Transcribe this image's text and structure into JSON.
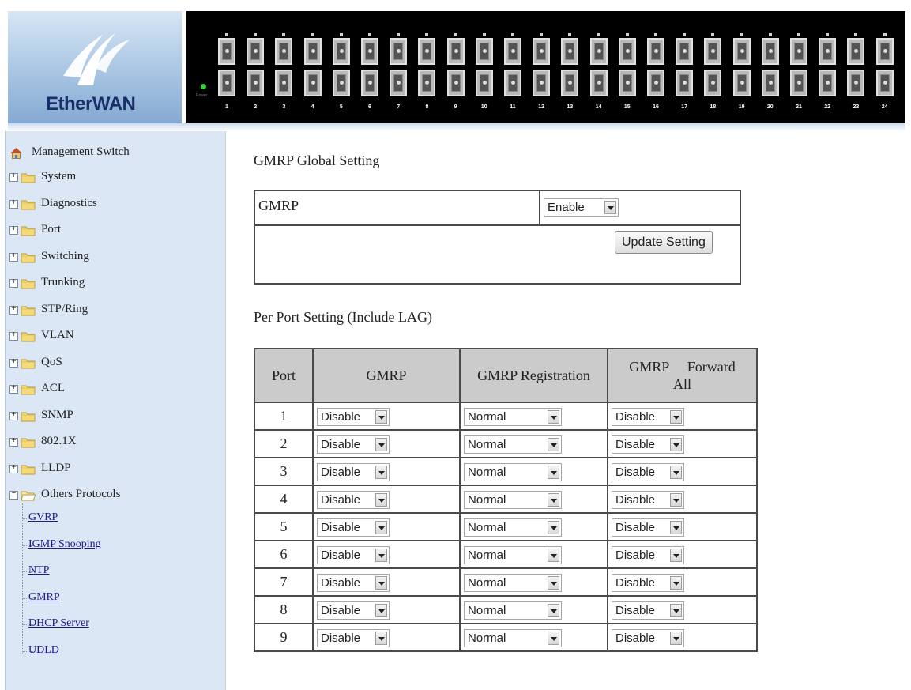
{
  "brand": {
    "logo_text_a": "Ether",
    "logo_text_b": "WAN"
  },
  "panel": {
    "power_label": "Power",
    "ports": [
      "1",
      "2",
      "3",
      "4",
      "5",
      "6",
      "7",
      "8",
      "9",
      "10",
      "11",
      "12",
      "13",
      "14",
      "15",
      "16",
      "17",
      "18",
      "19",
      "20",
      "21",
      "22",
      "23",
      "24"
    ]
  },
  "sidebar": {
    "root": "Management Switch",
    "groups": [
      "System",
      "Diagnostics",
      "Port",
      "Switching",
      "Trunking",
      "STP/Ring",
      "VLAN",
      "QoS",
      "ACL",
      "SNMP",
      "802.1X",
      "LLDP",
      "Others Protocols"
    ],
    "leaves": [
      "GVRP",
      "IGMP Snooping",
      "NTP",
      "GMRP",
      "DHCP Server",
      "UDLD"
    ]
  },
  "global": {
    "title": "GMRP Global Setting",
    "row_label": "GMRP",
    "value": "Enable",
    "update_button": "Update Setting"
  },
  "perport": {
    "title": "Per Port Setting (Include LAG)",
    "headers": [
      "Port",
      "GMRP",
      "GMRP Registration",
      "GMRP",
      "Forward",
      "All"
    ],
    "rows": [
      {
        "port": "1",
        "gmrp": "Disable",
        "registration": "Normal",
        "forward_all": "Disable"
      },
      {
        "port": "2",
        "gmrp": "Disable",
        "registration": "Normal",
        "forward_all": "Disable"
      },
      {
        "port": "3",
        "gmrp": "Disable",
        "registration": "Normal",
        "forward_all": "Disable"
      },
      {
        "port": "4",
        "gmrp": "Disable",
        "registration": "Normal",
        "forward_all": "Disable"
      },
      {
        "port": "5",
        "gmrp": "Disable",
        "registration": "Normal",
        "forward_all": "Disable"
      },
      {
        "port": "6",
        "gmrp": "Disable",
        "registration": "Normal",
        "forward_all": "Disable"
      },
      {
        "port": "7",
        "gmrp": "Disable",
        "registration": "Normal",
        "forward_all": "Disable"
      },
      {
        "port": "8",
        "gmrp": "Disable",
        "registration": "Normal",
        "forward_all": "Disable"
      },
      {
        "port": "9",
        "gmrp": "Disable",
        "registration": "Normal",
        "forward_all": "Disable"
      }
    ]
  },
  "colors": {
    "sidebar_bg": "#dbe7f4",
    "table_header_bg": "#cbcbcb",
    "link": "#1b1b8e",
    "panel_bg": "#000000"
  }
}
